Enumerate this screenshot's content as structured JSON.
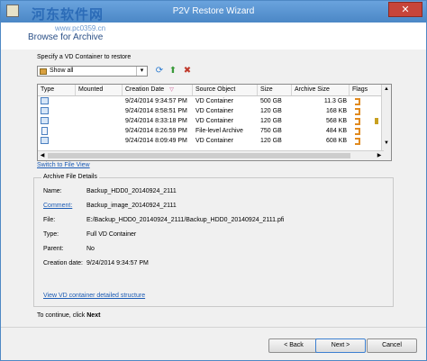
{
  "window": {
    "title": "P2V Restore Wizard",
    "close_label": "✕"
  },
  "watermark": {
    "text": "河东软件网",
    "sub": "www.pc0359.cn"
  },
  "page": {
    "heading": "Browse for Archive"
  },
  "specify_label": "Specify a VD Container to restore",
  "filter": {
    "selected": "Show all"
  },
  "table": {
    "columns": [
      "Type",
      "Mounted",
      "Creation Date",
      "Source Object",
      "Size",
      "Archive Size",
      "Flags"
    ],
    "rows": [
      {
        "creation_date": "9/24/2014 9:34:57 PM",
        "source_object": "VD Container",
        "size": "500 GB",
        "archive_size": "11.3 GB"
      },
      {
        "creation_date": "9/24/2014 8:58:51 PM",
        "source_object": "VD Container",
        "size": "120 GB",
        "archive_size": "168 KB"
      },
      {
        "creation_date": "9/24/2014 8:33:18 PM",
        "source_object": "VD Container",
        "size": "120 GB",
        "archive_size": "568 KB"
      },
      {
        "creation_date": "9/24/2014 8:26:59 PM",
        "source_object": "File-level Archive",
        "size": "750 GB",
        "archive_size": "484 KB"
      },
      {
        "creation_date": "9/24/2014 8:09:49 PM",
        "source_object": "VD Container",
        "size": "120 GB",
        "archive_size": "608 KB"
      }
    ]
  },
  "switch_link": "Switch to File View",
  "details": {
    "title": "Archive File Details",
    "fields": [
      {
        "label": "Name:",
        "value": "Backup_HDD0_20140924_2111"
      },
      {
        "label": "Comment:",
        "value": "Backup_image_20140924_2111"
      },
      {
        "label": "File:",
        "value": "E:/Backup_HDD0_20140924_2111/Backup_HDD0_20140924_2111.pfi"
      },
      {
        "label": "Type:",
        "value": "Full VD Container"
      },
      {
        "label": "Parent:",
        "value": "No"
      },
      {
        "label": "Creation date:",
        "value": "9/24/2014 9:34:57 PM"
      }
    ],
    "structure_link": "View VD container detailed structure"
  },
  "hint": {
    "prefix": "To continue, click ",
    "action": "Next"
  },
  "buttons": {
    "back": "< Back",
    "next": "Next >",
    "cancel": "Cancel"
  }
}
